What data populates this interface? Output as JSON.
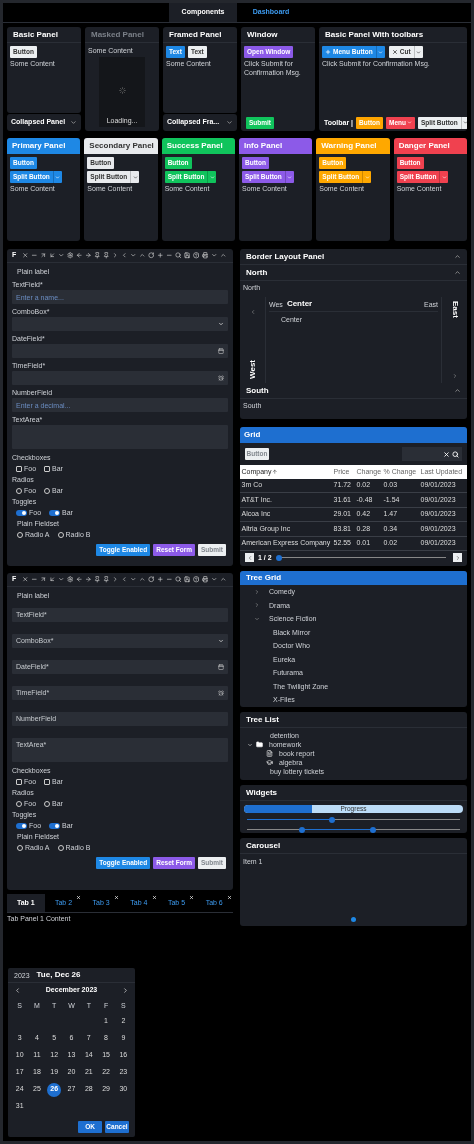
{
  "top_tabs": [
    {
      "label": "Components",
      "selected": true
    },
    {
      "label": "Dashboard",
      "selected": false
    }
  ],
  "basic_panel": {
    "title": "Basic Panel",
    "button": "Button",
    "content": "Some Content"
  },
  "collapsed_panel": {
    "title": "Collapsed Panel",
    "expanded": false
  },
  "masked_panel": {
    "title": "Masked Panel",
    "content": "Some Content",
    "mask_text": "Loading..."
  },
  "framed_panel": {
    "title": "Framed Panel",
    "buttons": [
      {
        "label": "Text",
        "color": "#1e88e5"
      },
      {
        "label": "Text",
        "color": "#eceff1"
      }
    ],
    "content": "Some Content"
  },
  "collapsed_framed_panel": {
    "title": "Collapsed Fra...",
    "expanded": false
  },
  "window_panel": {
    "title": "Window",
    "button": "Open Window",
    "content": "Click Submit for Confirmation Msg.",
    "footer_button": "Submit"
  },
  "toolbar_panel": {
    "title": "Basic Panel With toolbars",
    "menu_button": "Menu Button",
    "cut_button": "Cut",
    "content": "Click Submit for Confirmation Msg.",
    "toolbar_label": "Toolbar |",
    "toolbar_buttons": [
      {
        "label": "Button",
        "kind": "plain",
        "color": "#ffa500"
      },
      {
        "label": "Menu",
        "kind": "menu",
        "color": "#f0414f"
      },
      {
        "label": "Split Button",
        "kind": "split",
        "color": "#eceff1"
      }
    ]
  },
  "colored_panels": [
    {
      "title": "Primary Panel",
      "color": "#1e88e5",
      "button": "Button",
      "split_button": "Split Button",
      "content": "Some Content"
    },
    {
      "title": "Secondary Panel",
      "color": "#e8eaed",
      "button": "Button",
      "split_button": "Split Button",
      "content": "Some Content"
    },
    {
      "title": "Success Panel",
      "color": "#10c45c",
      "button": "Button",
      "split_button": "Split Button",
      "content": "Some Content"
    },
    {
      "title": "Info Panel",
      "color": "#8c5ae8",
      "button": "Button",
      "split_button": "Split Button",
      "content": "Some Content"
    },
    {
      "title": "Warning Panel",
      "color": "#ffa800",
      "button": "Button",
      "split_button": "Split Button",
      "content": "Some Content"
    },
    {
      "title": "Danger Panel",
      "color": "#f0414f",
      "button": "Button",
      "split_button": "Split Button",
      "content": "Some Content"
    }
  ],
  "forms": [
    {
      "toolbar_title": "F",
      "labels_inside": false,
      "plain_label": "Plain label",
      "fields": [
        {
          "label": "TextField*",
          "kind": "text",
          "placeholder": "Enter a name..."
        },
        {
          "label": "ComboBox*",
          "kind": "combo"
        },
        {
          "label": "DateField*",
          "kind": "date"
        },
        {
          "label": "TimeField*",
          "kind": "time"
        },
        {
          "label": "NumberField",
          "kind": "number",
          "placeholder": "Enter a decimal..."
        },
        {
          "label": "TextArea*",
          "kind": "textarea"
        }
      ],
      "checkboxes_label": "Checkboxes",
      "checkboxes": [
        {
          "label": "Foo",
          "checked": false
        },
        {
          "label": "Bar",
          "checked": false
        }
      ],
      "radios_label": "Radios",
      "radios": [
        {
          "label": "Foo",
          "selected": false
        },
        {
          "label": "Bar",
          "selected": false
        }
      ],
      "toggles_label": "Toggles",
      "toggles": [
        {
          "label": "Foo",
          "on": true
        },
        {
          "label": "Bar",
          "on": true
        }
      ],
      "fieldset_label": "Plain Fieldset",
      "fieldset_radios": [
        {
          "label": "Radio A",
          "selected": false
        },
        {
          "label": "Radio B",
          "selected": false
        }
      ],
      "buttons": [
        {
          "label": "Toggle Enabled",
          "color": "#1e88e5",
          "disabled": false
        },
        {
          "label": "Reset Form",
          "color": "#8c5ae8",
          "disabled": false
        },
        {
          "label": "Submit",
          "color": "#eceff1",
          "disabled": true
        }
      ]
    },
    {
      "toolbar_title": "F",
      "labels_inside": true,
      "plain_label": "Plain label",
      "fields": [
        {
          "label": "TextField*",
          "kind": "text"
        },
        {
          "label": "ComboBox*",
          "kind": "combo"
        },
        {
          "label": "DateField*",
          "kind": "date"
        },
        {
          "label": "TimeField*",
          "kind": "time"
        },
        {
          "label": "NumberField",
          "kind": "number"
        },
        {
          "label": "TextArea*",
          "kind": "textarea"
        }
      ],
      "checkboxes_label": "Checkboxes",
      "checkboxes": [
        {
          "label": "Foo",
          "checked": false
        },
        {
          "label": "Bar",
          "checked": false
        }
      ],
      "radios_label": "Radios",
      "radios": [
        {
          "label": "Foo",
          "selected": false
        },
        {
          "label": "Bar",
          "selected": false
        }
      ],
      "toggles_label": "Toggles",
      "toggles": [
        {
          "label": "Foo",
          "on": true
        },
        {
          "label": "Bar",
          "on": true
        }
      ],
      "fieldset_label": "Plain Fieldset",
      "fieldset_radios": [
        {
          "label": "Radio A",
          "selected": false
        },
        {
          "label": "Radio B",
          "selected": false
        }
      ],
      "buttons": [
        {
          "label": "Toggle Enabled",
          "color": "#1e88e5",
          "disabled": false
        },
        {
          "label": "Reset Form",
          "color": "#8c5ae8",
          "disabled": false
        },
        {
          "label": "Submit",
          "color": "#eceff1",
          "disabled": true
        }
      ]
    }
  ],
  "bottom_tabs": [
    {
      "label": "Tab 1",
      "selected": true,
      "closable": false
    },
    {
      "label": "Tab 2",
      "selected": false,
      "closable": true
    },
    {
      "label": "Tab 3",
      "selected": false,
      "closable": true
    },
    {
      "label": "Tab 4",
      "selected": false,
      "closable": true
    },
    {
      "label": "Tab 5",
      "selected": false,
      "closable": true
    },
    {
      "label": "Tab 6",
      "selected": false,
      "closable": true
    }
  ],
  "tab_content": "Tab Panel 1 Content",
  "calendar": {
    "year": "2023",
    "date": "Tue, Dec 26",
    "month": "December 2023",
    "weekdays": [
      "S",
      "M",
      "T",
      "W",
      "T",
      "F",
      "S"
    ],
    "weeks": [
      [
        {
          "day": "1",
          "selected": false
        },
        {
          "day": "2",
          "selected": false
        }
      ],
      [
        {
          "day": "3",
          "selected": false
        },
        {
          "day": "4",
          "selected": false
        },
        {
          "day": "5",
          "selected": false
        },
        {
          "day": "6",
          "selected": false
        },
        {
          "day": "7",
          "selected": false
        },
        {
          "day": "8",
          "selected": false
        },
        {
          "day": "9",
          "selected": false
        }
      ],
      [
        {
          "day": "10",
          "selected": false
        },
        {
          "day": "11",
          "selected": false
        },
        {
          "day": "12",
          "selected": false
        },
        {
          "day": "13",
          "selected": false
        },
        {
          "day": "14",
          "selected": false
        },
        {
          "day": "15",
          "selected": false
        },
        {
          "day": "16",
          "selected": false
        }
      ],
      [
        {
          "day": "17",
          "selected": false
        },
        {
          "day": "18",
          "selected": false
        },
        {
          "day": "19",
          "selected": false
        },
        {
          "day": "20",
          "selected": false
        },
        {
          "day": "21",
          "selected": false
        },
        {
          "day": "22",
          "selected": false
        },
        {
          "day": "23",
          "selected": false
        }
      ],
      [
        {
          "day": "24",
          "selected": false
        },
        {
          "day": "25",
          "selected": false
        },
        {
          "day": "26",
          "selected": true
        },
        {
          "day": "27",
          "selected": false
        },
        {
          "day": "28",
          "selected": false
        },
        {
          "day": "29",
          "selected": false
        },
        {
          "day": "30",
          "selected": false
        }
      ],
      [
        {
          "day": "31",
          "selected": false
        }
      ]
    ],
    "buttons": [
      "OK",
      "Cancel"
    ]
  },
  "border_layout": {
    "title": "Border Layout Panel",
    "expanded": true,
    "north": {
      "title": "North",
      "expanded": true,
      "content": "North"
    },
    "west": {
      "title": "West",
      "expanded": false
    },
    "center": {
      "west_label": "Wes",
      "title": "Center",
      "content": "Center",
      "east_label": "East"
    },
    "east": {
      "title": "East",
      "expanded": false
    },
    "south": {
      "title": "South",
      "expanded": true,
      "content": "South"
    }
  },
  "grid": {
    "title": "Grid",
    "toolbar_button": "Button",
    "columns": [
      {
        "label": "Company",
        "sorted": true
      },
      {
        "label": "Price",
        "sorted": false
      },
      {
        "label": "Change",
        "sorted": false
      },
      {
        "label": "% Change",
        "sorted": false
      },
      {
        "label": "Last Updated",
        "sorted": false
      }
    ],
    "rows": [
      [
        "3m Co",
        "71.72",
        "0.02",
        "0.03",
        "09/01/2023"
      ],
      [
        "AT&T Inc.",
        "31.61",
        "-0.48",
        "-1.54",
        "09/01/2023"
      ],
      [
        "Alcoa Inc",
        "29.01",
        "0.42",
        "1.47",
        "09/01/2023"
      ],
      [
        "Altria Group Inc",
        "83.81",
        "0.28",
        "0.34",
        "09/01/2023"
      ],
      [
        "American Express Company",
        "52.55",
        "0.01",
        "0.02",
        "09/01/2023"
      ]
    ],
    "pager": {
      "page": "1 / 2",
      "level": 0
    }
  },
  "tree_grid": {
    "title": "Tree Grid",
    "rows": [
      {
        "label": "Comedy",
        "expanded": false
      },
      {
        "label": "Drama",
        "expanded": false
      },
      {
        "label": "Science Fiction",
        "expanded": true,
        "children": [
          {
            "label": "Black Mirror"
          },
          {
            "label": "Doctor Who"
          },
          {
            "label": "Eureka"
          },
          {
            "label": "Futurama"
          },
          {
            "label": "The Twilight Zone"
          },
          {
            "label": "X-Files"
          }
        ]
      }
    ]
  },
  "tree_list": {
    "title": "Tree List",
    "items": [
      {
        "label": "detention",
        "kind": "plain"
      },
      {
        "label": "homework",
        "kind": "folder",
        "expanded": true,
        "children": [
          {
            "label": "book report",
            "kind": "book"
          },
          {
            "label": "algebra",
            "kind": "cap"
          }
        ]
      },
      {
        "label": "buy lottery tickets",
        "kind": "plain"
      }
    ]
  },
  "widgets": {
    "title": "Widgets",
    "progress": {
      "label": "Progress",
      "level": 0.31
    },
    "slider": {
      "level": 0.4
    },
    "range_slider": {
      "thumbs": [
        {
          "level": 0.26
        },
        {
          "level": 0.59
        }
      ]
    }
  },
  "carousel": {
    "title": "Carousel",
    "item": "Item 1",
    "dots": [
      {
        "selected": true
      }
    ]
  }
}
